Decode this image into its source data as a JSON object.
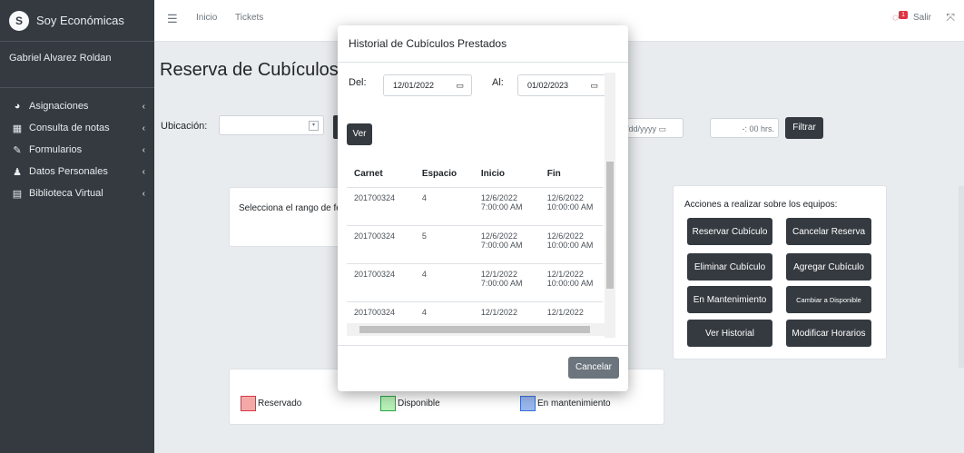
{
  "app": {
    "brand": "Soy Económicas",
    "logo_letter": "S"
  },
  "sidebar": {
    "user": "Gabriel Alvarez Roldan",
    "items": [
      {
        "label": "Asignaciones",
        "icon": "tachometer-icon"
      },
      {
        "label": "Consulta de notas",
        "icon": "table-icon"
      },
      {
        "label": "Formularios",
        "icon": "edit-icon"
      },
      {
        "label": "Datos Personales",
        "icon": "user-icon"
      },
      {
        "label": "Biblioteca Virtual",
        "icon": "book-icon"
      }
    ]
  },
  "navbar": {
    "home": "Inicio",
    "tickets": "Tickets",
    "notif_count": "1",
    "logout": "Salir"
  },
  "page": {
    "title": "Reserva de Cubículos",
    "ubicacion_label": "Ubicación:",
    "date_placeholder": "/dd/yyyy",
    "time_suffix": "-: 00 hrs.",
    "filter_button": "Filtrar",
    "select_range_text": "Selecciona el rango de fe"
  },
  "actions": {
    "title": "Acciones a realizar sobre los equipos:",
    "buttons": [
      "Reservar Cubículo",
      "Cancelar Reserva",
      "Eliminar Cubículo",
      "Agregar Cubículo",
      "En Mantenimiento",
      "Cambiar a Disponible",
      "Ver Historial",
      "Modificar Horarios"
    ]
  },
  "legend": [
    {
      "label": "Reservado",
      "color": "#f4a9a8",
      "border": "#dc3545"
    },
    {
      "label": "Disponible",
      "color": "#b7f0b7",
      "border": "#28a745"
    },
    {
      "label": "En mantenimiento",
      "color": "#9ab8f0",
      "border": "#3b6fd4"
    }
  ],
  "modal": {
    "title": "Historial de Cubículos Prestados",
    "from_label": "Del:",
    "from_value": "12/01/2022",
    "to_label": "Al:",
    "to_value": "01/02/2023",
    "ver_button": "Ver",
    "columns": [
      "Carnet",
      "Espacio",
      "Inicio",
      "Fin"
    ],
    "rows": [
      [
        "201700324",
        "4",
        "12/6/2022",
        "7:00:00 AM",
        "12/6/2022",
        "10:00:00 AM"
      ],
      [
        "201700324",
        "5",
        "12/6/2022",
        "7:00:00 AM",
        "12/6/2022",
        "10:00:00 AM"
      ],
      [
        "201700324",
        "4",
        "12/1/2022",
        "7:00:00 AM",
        "12/1/2022",
        "10:00:00 AM"
      ],
      [
        "201700324",
        "4",
        "12/1/2022",
        "",
        "12/1/2022",
        ""
      ]
    ],
    "cancel_button": "Cancelar"
  }
}
